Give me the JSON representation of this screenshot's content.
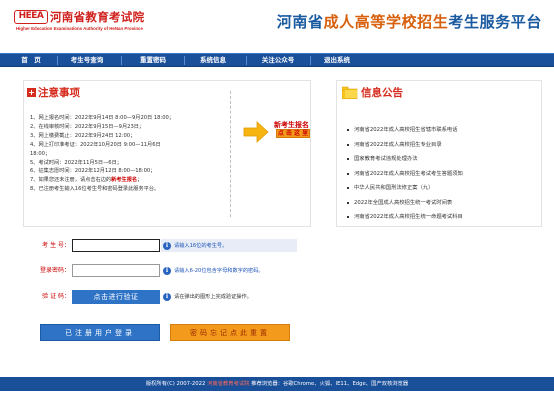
{
  "header": {
    "logo_mark": "HEEA",
    "logo_cn": "河南省教育考试院",
    "logo_en": "Higher Education Examinations Authority of HeNan Province",
    "title_part1": "河南省",
    "title_part2": "成人高等学校招生",
    "title_part3": "考生服务平台"
  },
  "nav": {
    "items": [
      {
        "label": "首　页"
      },
      {
        "label": "考生号查询"
      },
      {
        "label": "重置密码"
      },
      {
        "label": "系统信息"
      },
      {
        "label": "关注公众号"
      },
      {
        "label": "退出系统"
      }
    ]
  },
  "notice": {
    "title": "注意事项",
    "items": [
      "1、网上报名时间：2022年9月14日 8:00—9月20日 18:00；",
      "2、在线审核时间：2022年9月15日—9月23日；",
      "3、网上缴费截止：2022年9月24日 12:00；",
      "4、网上打印准考证：2022年10月20日 9:00—11月6日",
      "    18:00；",
      "5、考试时间：2022年11月5日—6日；",
      "6、征集志愿时间：2022年12月12日 8:00—18:00；",
      "7、如果您还未注册，请点击右边的",
      "8、已注册考生输入16位考生号和密码登录此服务平台。"
    ],
    "item7_emphasis": "新考生报名",
    "item7_tail": "；",
    "register_title": "新考生报名",
    "register_button": "点 击 这 里"
  },
  "announcements": {
    "title": "信息公告",
    "items": [
      "河南省2022年成人高校招生省辖市联系电话",
      "河南省2022年成人高校招生专业目录",
      "国家教育考试违规处理办法",
      "河南省2022年成人高校招生考试考生答题须知",
      "中华人民共和国刑法修正案（九）",
      "2022年全国成人高校招生统一考试时间表",
      "河南省2022年成人高校招生统一命题考试科目"
    ]
  },
  "form": {
    "candidate_label": "考 生 号：",
    "candidate_value": "",
    "candidate_hint": "请输入16位的考生号。",
    "password_label": "登录密码：",
    "password_value": "",
    "password_hint": "请输入6-20位包含字母和数字的密码。",
    "verify_label": "验 证 码：",
    "verify_button": "点击进行验证",
    "verify_hint": "请在弹出的图形上完成验证操作。"
  },
  "buttons": {
    "login": "已注册用户登录",
    "forgot": "密码忘记点此重置"
  },
  "footer": {
    "text_before": "版权所有(C) 2007-2022 ",
    "link_text": "河南省教育考试院",
    "text_after": "  推荐浏览器：谷歌Chrome、火狐、IE11、Edge、国产双核浏览器"
  },
  "colors": {
    "nav_bg": "#1a4f9a",
    "accent_red": "#d62a1c",
    "primary_blue": "#2f73c6",
    "orange": "#f39a1c"
  }
}
